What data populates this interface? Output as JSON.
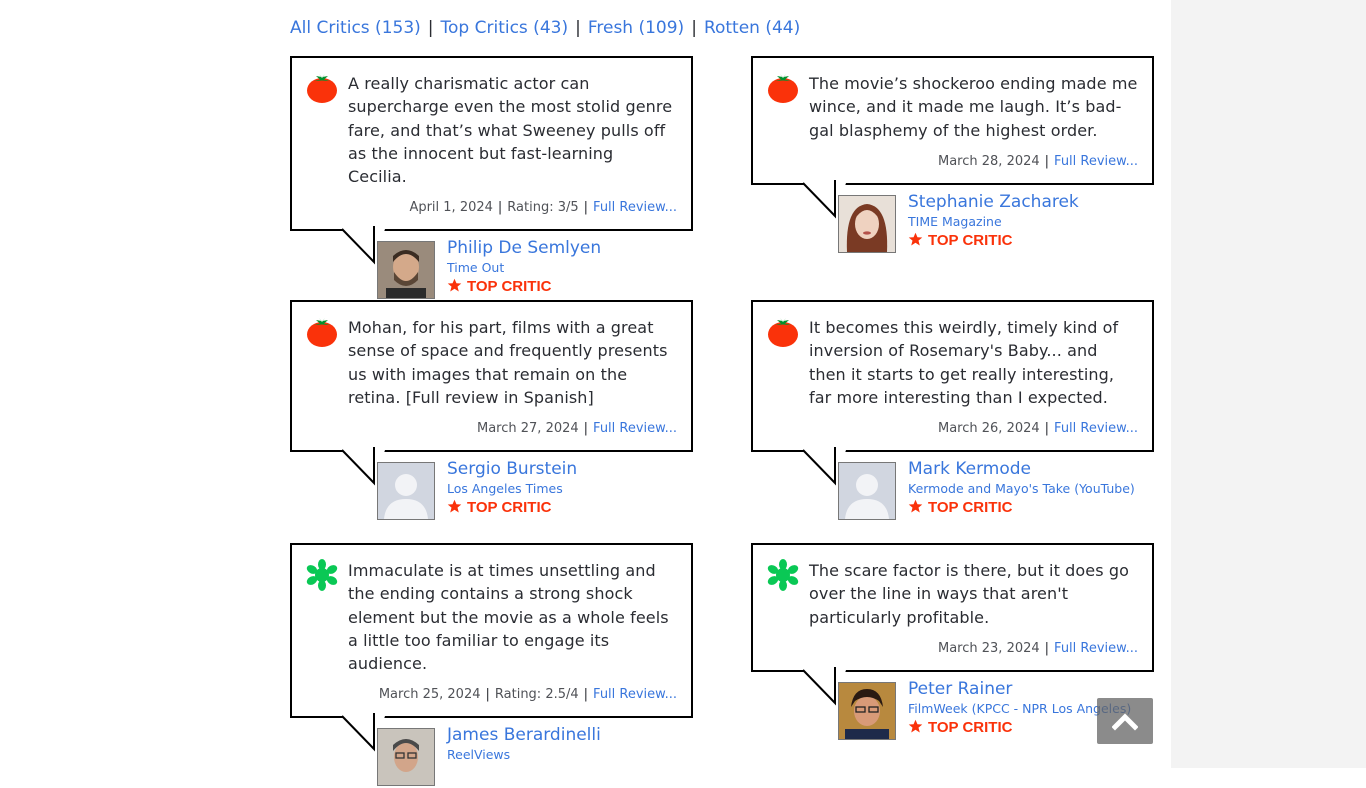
{
  "filters": {
    "all": "All Critics (153)",
    "top": "Top Critics (43)",
    "fresh": "Fresh (109)",
    "rotten": "Rotten (44)",
    "separator": "|"
  },
  "labels": {
    "top_critic": "TOP CRITIC",
    "full_review": "Full Review...",
    "separator": "|"
  },
  "colors": {
    "link": "#3976dc",
    "fresh_tomato": "#fa320a",
    "rotten_splat": "#0ac855",
    "top_critic": "#fa320a",
    "border": "#000000"
  },
  "reviews": [
    {
      "icon": "fresh-tomato-icon",
      "quote": "A really charismatic actor can supercharge even the most stolid genre fare, and that’s what Sweeney pulls off as the innocent but fast-learning Cecilia.",
      "date": "April 1, 2024",
      "rating": "Rating: 3/5",
      "critic": "Philip De Semlyen",
      "publication": "Time Out",
      "top_critic": true,
      "avatar": "photo"
    },
    {
      "icon": "fresh-tomato-icon",
      "quote": "The movie’s shockeroo ending made me wince, and it made me laugh. It’s bad-gal blasphemy of the highest order.",
      "date": "March 28, 2024",
      "rating": "",
      "critic": "Stephanie Zacharek",
      "publication": "TIME Magazine",
      "top_critic": true,
      "avatar": "photo"
    },
    {
      "icon": "fresh-tomato-icon",
      "quote": "Mohan, for his part, films with a great sense of space and frequently presents us with images that remain on the retina. [Full review in Spanish]",
      "date": "March 27, 2024",
      "rating": "",
      "critic": "Sergio Burstein",
      "publication": "Los Angeles Times",
      "top_critic": true,
      "avatar": "placeholder"
    },
    {
      "icon": "fresh-tomato-icon",
      "quote": "It becomes this weirdly, timely kind of inversion of Rosemary's Baby... and then it starts to get really interesting, far more interesting than I expected.",
      "date": "March 26, 2024",
      "rating": "",
      "critic": "Mark Kermode",
      "publication": "Kermode and Mayo's Take (YouTube)",
      "top_critic": true,
      "avatar": "placeholder"
    },
    {
      "icon": "rotten-splat-icon",
      "quote": "Immaculate is at times unsettling and the ending contains a strong shock element but the movie as a whole feels a little too familiar to engage its audience.",
      "date": "March 25, 2024",
      "rating": "Rating: 2.5/4",
      "critic": "James Berardinelli",
      "publication": "ReelViews",
      "top_critic": false,
      "avatar": "photo"
    },
    {
      "icon": "rotten-splat-icon",
      "quote": "The scare factor is there, but it does go over the line in ways that aren't particularly profitable.",
      "date": "March 23, 2024",
      "rating": "",
      "critic": "Peter Rainer",
      "publication": "FilmWeek (KPCC - NPR Los Angeles)",
      "top_critic": true,
      "avatar": "photo"
    }
  ],
  "scroll_top": {
    "icon": "chevron-up-icon"
  }
}
